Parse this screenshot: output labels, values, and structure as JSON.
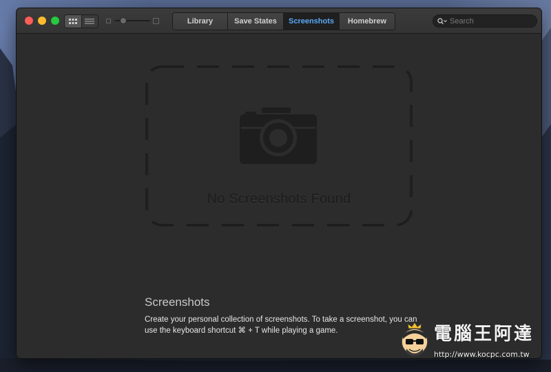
{
  "window": {
    "tabs": [
      {
        "label": "Library",
        "active": false
      },
      {
        "label": "Save States",
        "active": false
      },
      {
        "label": "Screenshots",
        "active": true
      },
      {
        "label": "Homebrew",
        "active": false
      }
    ],
    "search_placeholder": "Search",
    "view_modes": [
      "grid-view-icon",
      "list-view-icon"
    ],
    "accent_color": "#5aa9f5"
  },
  "empty_state": {
    "title": "No Screenshots Found",
    "icon": "camera-icon"
  },
  "info": {
    "heading": "Screenshots",
    "description": "Create your personal collection of screenshots. To take a screenshot, you can use the keyboard shortcut ⌘ + T while playing a game."
  },
  "watermark": {
    "title": "電腦王阿達",
    "url": "http://www.kocpc.com.tw"
  }
}
